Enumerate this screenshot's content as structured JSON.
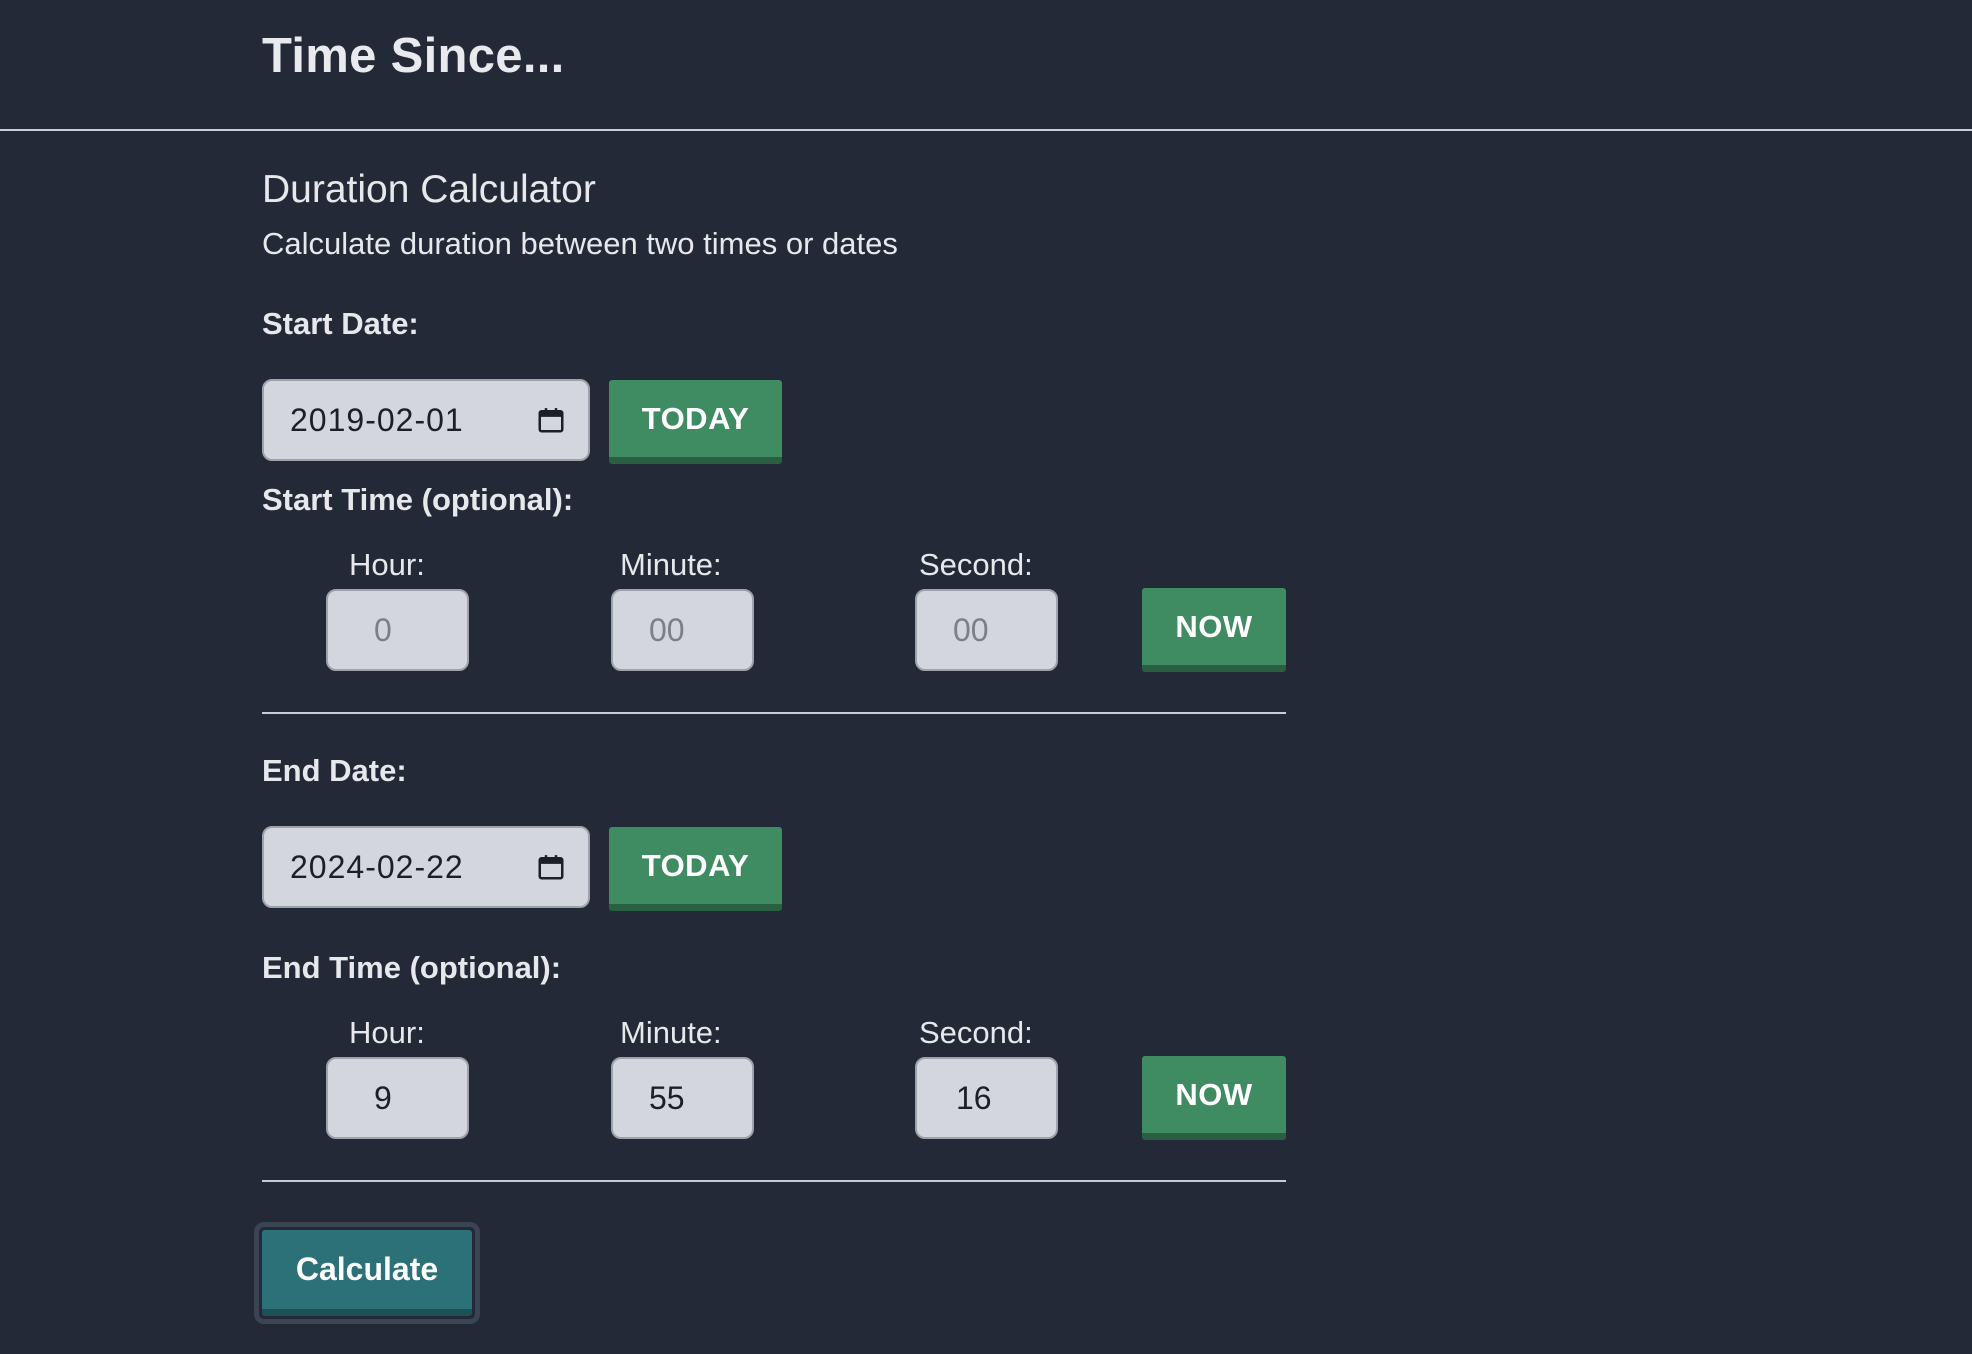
{
  "header": {
    "title": "Time Since..."
  },
  "calculator": {
    "title": "Duration Calculator",
    "subtitle": "Calculate duration between two times or dates"
  },
  "start": {
    "date_label": "Start Date:",
    "date_value": "2019-02-01",
    "today_label": "TODAY",
    "time_label": "Start Time (optional):",
    "hour_label": "Hour:",
    "minute_label": "Minute:",
    "second_label": "Second:",
    "hour_placeholder": "0",
    "minute_placeholder": "00",
    "second_placeholder": "00",
    "now_label": "NOW"
  },
  "end": {
    "date_label": "End Date:",
    "date_value": "2024-02-22",
    "today_label": "TODAY",
    "time_label": "End Time (optional):",
    "hour_label": "Hour:",
    "minute_label": "Minute:",
    "second_label": "Second:",
    "hour_value": "9",
    "minute_value": "55",
    "second_value": "16",
    "now_label": "NOW"
  },
  "actions": {
    "calculate_label": "Calculate"
  },
  "icons": {
    "calendar": "calendar-icon"
  },
  "colors": {
    "background": "#232936",
    "input_bg": "#d3d6dc",
    "button_green": "#3f8c62",
    "button_teal": "#2d7178"
  }
}
